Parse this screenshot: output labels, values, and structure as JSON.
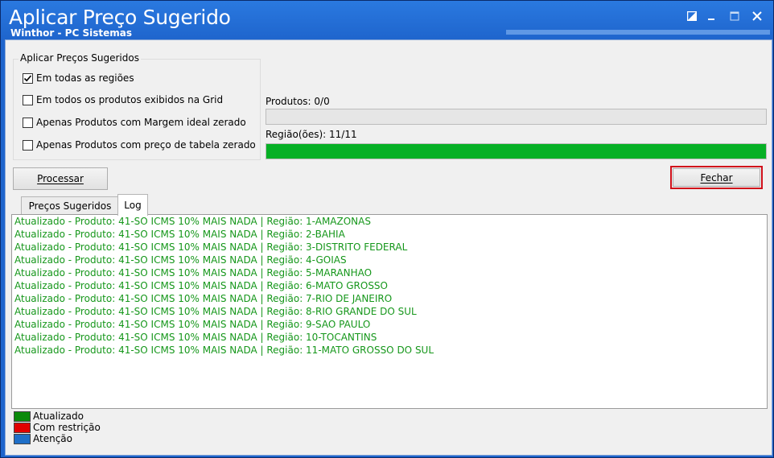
{
  "window": {
    "title": "Aplicar Preço Sugerido",
    "subtitle": "Winthor - PC Sistemas",
    "controls": [
      "restore-icon",
      "minimize-icon",
      "maximize-icon",
      "close-icon"
    ]
  },
  "options_group": {
    "title": "Aplicar Preços Sugeridos",
    "options": [
      {
        "label": "Em todas as regiões",
        "checked": true
      },
      {
        "label": "Em todos os produtos exibidos na Grid",
        "checked": false
      },
      {
        "label": "Apenas Produtos com Margem ideal zerado",
        "checked": false
      },
      {
        "label": "Apenas Produtos com preço de tabela zerado",
        "checked": false
      }
    ]
  },
  "progress": {
    "produtos": {
      "label": "Produtos: 0/0",
      "fraction": 0
    },
    "regioes": {
      "label": "Região(ões): 11/11",
      "fraction": 1
    }
  },
  "buttons": {
    "processar": "Processar",
    "fechar": "Fechar"
  },
  "tabs": [
    {
      "label": "Preços Sugeridos",
      "active": false
    },
    {
      "label": "Log",
      "active": true
    }
  ],
  "log": [
    "Atualizado - Produto: 41-SO ICMS 10% MAIS NADA | Região: 1-AMAZONAS",
    "Atualizado - Produto: 41-SO ICMS 10% MAIS NADA | Região: 2-BAHIA",
    "Atualizado - Produto: 41-SO ICMS 10% MAIS NADA | Região: 3-DISTRITO FEDERAL",
    "Atualizado - Produto: 41-SO ICMS 10% MAIS NADA | Região: 4-GOIAS",
    "Atualizado - Produto: 41-SO ICMS 10% MAIS NADA | Região: 5-MARANHAO",
    "Atualizado - Produto: 41-SO ICMS 10% MAIS NADA | Região: 6-MATO GROSSO",
    "Atualizado - Produto: 41-SO ICMS 10% MAIS NADA | Região: 7-RIO DE JANEIRO",
    "Atualizado - Produto: 41-SO ICMS 10% MAIS NADA | Região: 8-RIO GRANDE DO SUL",
    "Atualizado - Produto: 41-SO ICMS 10% MAIS NADA | Região: 9-SAO PAULO",
    "Atualizado - Produto: 41-SO ICMS 10% MAIS NADA | Região: 10-TOCANTINS",
    "Atualizado - Produto: 41-SO ICMS 10% MAIS NADA | Região: 11-MATO GROSSO DO SUL"
  ],
  "log_color": "#16971b",
  "legend": [
    {
      "label": "Atualizado",
      "color": "#0a8a0a"
    },
    {
      "label": "Com restrição",
      "color": "#e00000"
    },
    {
      "label": "Atenção",
      "color": "#1e6fc8"
    }
  ]
}
